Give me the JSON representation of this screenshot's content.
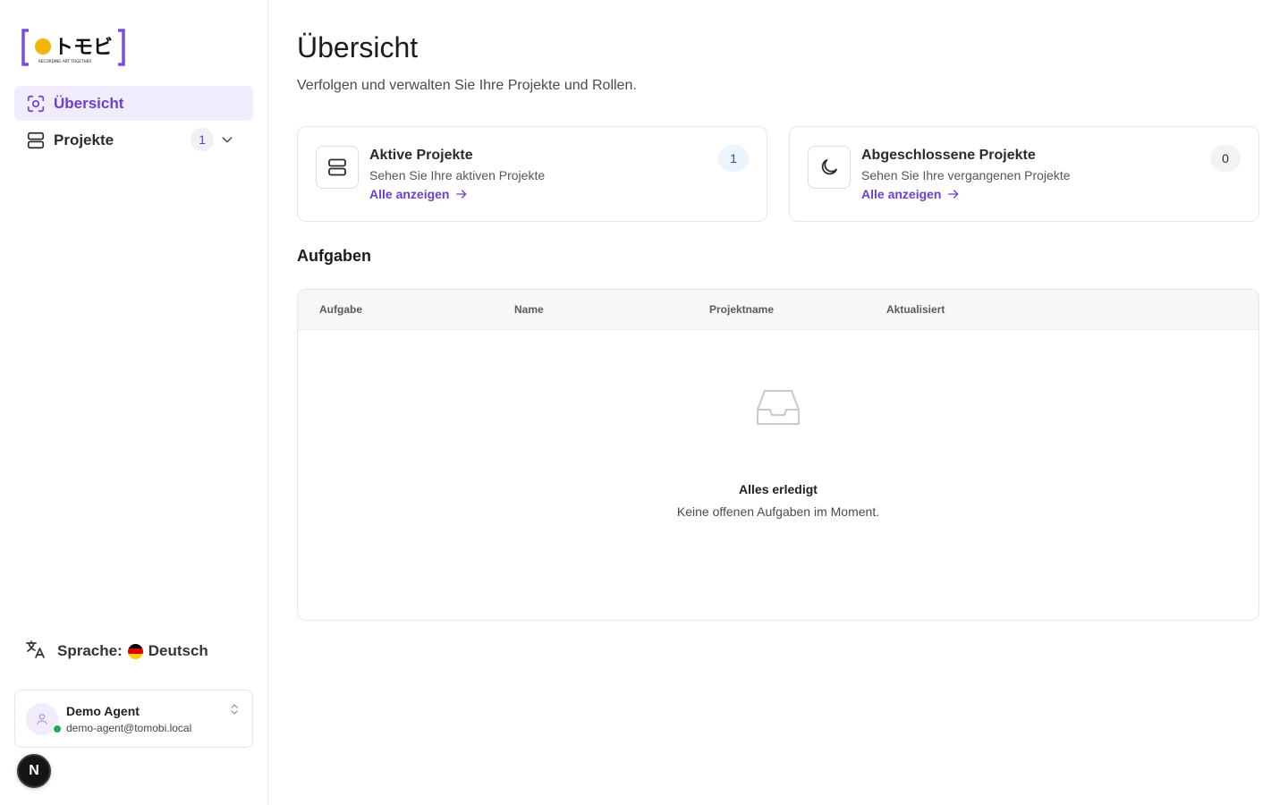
{
  "sidebar": {
    "logo": {
      "text": "トモビ",
      "tagline": "RECORDING ART TOGETHER",
      "accent": "#7a4fd6",
      "dot": "#f2b705"
    },
    "nav": [
      {
        "label": "Übersicht",
        "icon": "overview-scan-icon",
        "active": true
      },
      {
        "label": "Projekte",
        "icon": "projects-stack-icon",
        "badge": "1",
        "active": false
      }
    ],
    "language": {
      "label": "Sprache:",
      "value": "Deutsch",
      "flag": "de"
    },
    "user": {
      "name": "Demo Agent",
      "email": "demo-agent@tomobi.local",
      "status": "online"
    }
  },
  "devtools": {
    "label": "N"
  },
  "main": {
    "title": "Übersicht",
    "subtitle": "Verfolgen und verwalten Sie Ihre Projekte und Rollen.",
    "cards": [
      {
        "title": "Aktive Projekte",
        "description": "Sehen Sie Ihre aktiven Projekte",
        "link": "Alle anzeigen",
        "count": "1",
        "icon": "server-stack-icon"
      },
      {
        "title": "Abgeschlossene Projekte",
        "description": "Sehen Sie Ihre vergangenen Projekte",
        "link": "Alle anzeigen",
        "count": "0",
        "icon": "moon-icon"
      }
    ],
    "tasks": {
      "title": "Aufgaben",
      "columns": [
        "Aufgabe",
        "Name",
        "Projektname",
        "Aktualisiert"
      ],
      "empty_title": "Alles erledigt",
      "empty_subtitle": "Keine offenen Aufgaben im Moment."
    }
  },
  "colors": {
    "accent": "#6b3fd0",
    "active_bg": "#f1ecfc",
    "border": "#e6e6ea",
    "online": "#22a955"
  }
}
